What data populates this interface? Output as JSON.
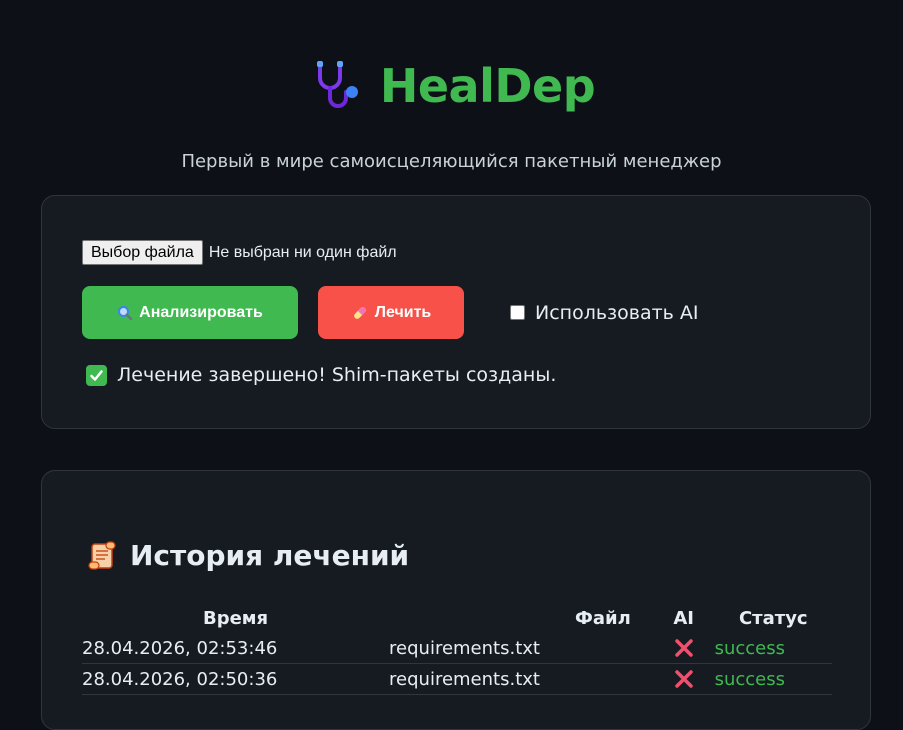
{
  "header": {
    "title": "HealDep",
    "subtitle": "Первый в мире самоисцеляющийся пакетный менеджер"
  },
  "upload": {
    "file_button_label": "Выбор файла",
    "file_status": "Не выбран ни один файл"
  },
  "actions": {
    "analyze_label": "Анализировать",
    "heal_label": "Лечить",
    "use_ai_label": "Использовать AI",
    "use_ai_checked": false
  },
  "status_message": "Лечение завершено! Shim-пакеты созданы.",
  "history": {
    "title": "История лечений",
    "columns": [
      "Время",
      "Файл",
      "AI",
      "Статус"
    ],
    "rows": [
      {
        "time": "28.04.2026, 02:53:46",
        "file": "requirements.txt",
        "ai": "cross-icon",
        "status": "success"
      },
      {
        "time": "28.04.2026, 02:50:36",
        "file": "requirements.txt",
        "ai": "cross-icon",
        "status": "success"
      }
    ]
  },
  "colors": {
    "background": "#0d1117",
    "card": "#161b22",
    "accent_green": "#3fb950",
    "accent_red": "#f85149",
    "cross_red": "#f0506e"
  }
}
